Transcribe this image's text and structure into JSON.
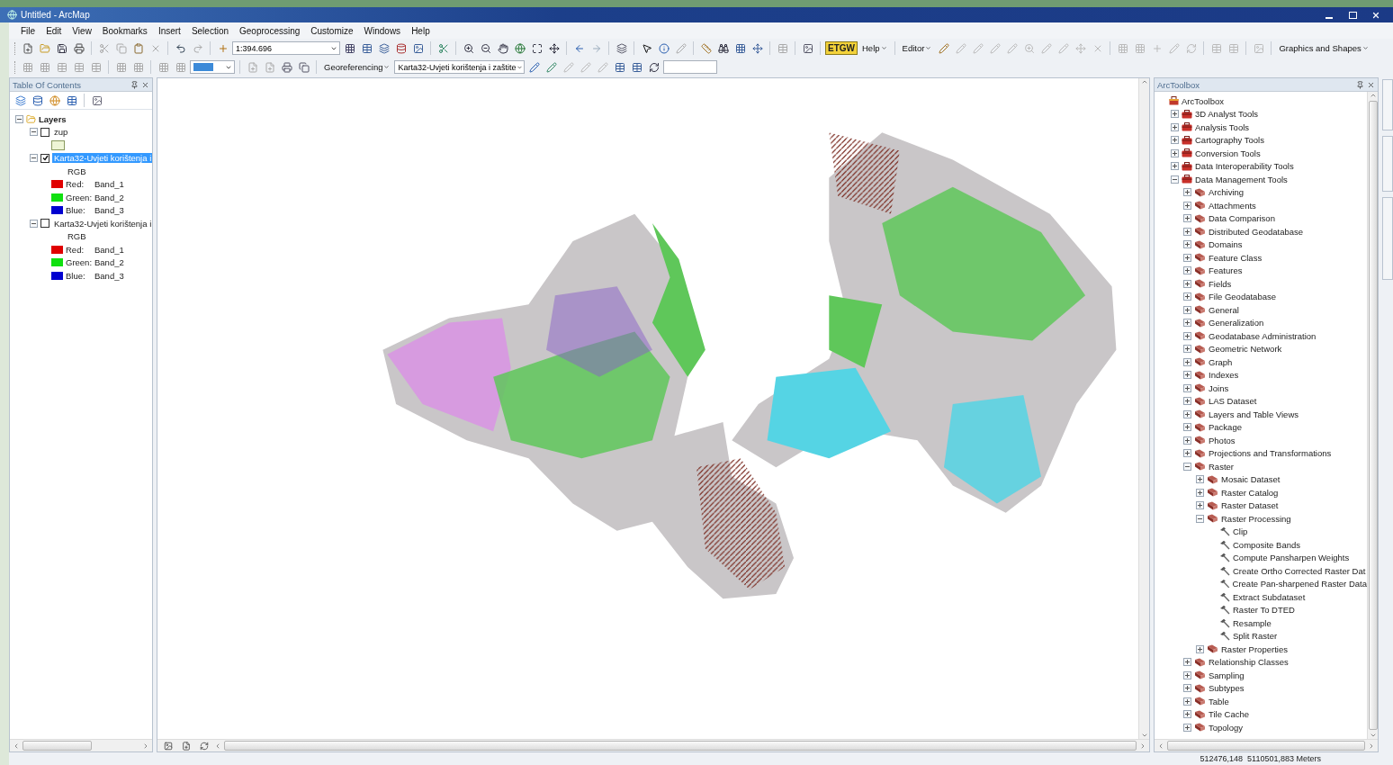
{
  "window": {
    "title": "Untitled - ArcMap"
  },
  "menu": [
    "File",
    "Edit",
    "View",
    "Bookmarks",
    "Insert",
    "Selection",
    "Geoprocessing",
    "Customize",
    "Windows",
    "Help"
  ],
  "toolbar_1": {
    "scale": "1:394.696",
    "logo": "ETGW",
    "menus": [
      "Help",
      "Editor",
      "Graphics and Shapes"
    ]
  },
  "toolbar_2": {
    "georeferencing": "Georeferencing",
    "layer": "Karta32-Uvjeti korištenja i zaštite"
  },
  "toc": {
    "title": "Table Of Contents",
    "root": {
      "label": "Layers",
      "expanded": true,
      "layers": [
        {
          "label": "zup",
          "checked": false,
          "selected": false,
          "expanded": true,
          "legend": [
            {
              "kind": "patch",
              "color": "#eef5d6"
            }
          ]
        },
        {
          "label": "Karta32-Uvjeti korištenja i",
          "checked": true,
          "selected": true,
          "expanded": true,
          "legend": [
            {
              "kind": "heading",
              "text": "RGB"
            },
            {
              "kind": "band",
              "color": "#e00000",
              "channel": "Red:",
              "band": "Band_1"
            },
            {
              "kind": "band",
              "color": "#10e010",
              "channel": "Green:",
              "band": "Band_2"
            },
            {
              "kind": "band",
              "color": "#0000d0",
              "channel": "Blue:",
              "band": "Band_3"
            }
          ]
        },
        {
          "label": "Karta32-Uvjeti korištenja i",
          "checked": false,
          "selected": false,
          "expanded": true,
          "legend": [
            {
              "kind": "heading",
              "text": "RGB"
            },
            {
              "kind": "band",
              "color": "#e00000",
              "channel": "Red:",
              "band": "Band_1"
            },
            {
              "kind": "band",
              "color": "#10e010",
              "channel": "Green:",
              "band": "Band_2"
            },
            {
              "kind": "band",
              "color": "#0000d0",
              "channel": "Blue:",
              "band": "Band_3"
            }
          ]
        }
      ]
    }
  },
  "toolbox": {
    "title": "ArcToolbox",
    "root": {
      "kind": "root",
      "label": "ArcToolbox",
      "children": [
        {
          "kind": "toolbox",
          "label": "3D Analyst Tools",
          "expanded": false
        },
        {
          "kind": "toolbox",
          "label": "Analysis Tools",
          "expanded": false
        },
        {
          "kind": "toolbox",
          "label": "Cartography Tools",
          "expanded": false
        },
        {
          "kind": "toolbox",
          "label": "Conversion Tools",
          "expanded": false
        },
        {
          "kind": "toolbox",
          "label": "Data Interoperability Tools",
          "expanded": false
        },
        {
          "kind": "toolbox",
          "label": "Data Management Tools",
          "expanded": true,
          "children": [
            {
              "kind": "toolset",
              "label": "Archiving",
              "expanded": false
            },
            {
              "kind": "toolset",
              "label": "Attachments",
              "expanded": false
            },
            {
              "kind": "toolset",
              "label": "Data Comparison",
              "expanded": false
            },
            {
              "kind": "toolset",
              "label": "Distributed Geodatabase",
              "expanded": false
            },
            {
              "kind": "toolset",
              "label": "Domains",
              "expanded": false
            },
            {
              "kind": "toolset",
              "label": "Feature Class",
              "expanded": false
            },
            {
              "kind": "toolset",
              "label": "Features",
              "expanded": false
            },
            {
              "kind": "toolset",
              "label": "Fields",
              "expanded": false
            },
            {
              "kind": "toolset",
              "label": "File Geodatabase",
              "expanded": false
            },
            {
              "kind": "toolset",
              "label": "General",
              "expanded": false
            },
            {
              "kind": "toolset",
              "label": "Generalization",
              "expanded": false
            },
            {
              "kind": "toolset",
              "label": "Geodatabase Administration",
              "expanded": false
            },
            {
              "kind": "toolset",
              "label": "Geometric Network",
              "expanded": false
            },
            {
              "kind": "toolset",
              "label": "Graph",
              "expanded": false
            },
            {
              "kind": "toolset",
              "label": "Indexes",
              "expanded": false
            },
            {
              "kind": "toolset",
              "label": "Joins",
              "expanded": false
            },
            {
              "kind": "toolset",
              "label": "LAS Dataset",
              "expanded": false
            },
            {
              "kind": "toolset",
              "label": "Layers and Table Views",
              "expanded": false
            },
            {
              "kind": "toolset",
              "label": "Package",
              "expanded": false
            },
            {
              "kind": "toolset",
              "label": "Photos",
              "expanded": false
            },
            {
              "kind": "toolset",
              "label": "Projections and Transformations",
              "expanded": false
            },
            {
              "kind": "toolset",
              "label": "Raster",
              "expanded": true,
              "children": [
                {
                  "kind": "toolset",
                  "label": "Mosaic Dataset",
                  "expanded": false
                },
                {
                  "kind": "toolset",
                  "label": "Raster Catalog",
                  "expanded": false
                },
                {
                  "kind": "toolset",
                  "label": "Raster Dataset",
                  "expanded": false
                },
                {
                  "kind": "toolset",
                  "label": "Raster Processing",
                  "expanded": true,
                  "children": [
                    {
                      "kind": "tool",
                      "label": "Clip"
                    },
                    {
                      "kind": "tool",
                      "label": "Composite Bands"
                    },
                    {
                      "kind": "tool",
                      "label": "Compute Pansharpen Weights"
                    },
                    {
                      "kind": "tool",
                      "label": "Create Ortho Corrected Raster Dat"
                    },
                    {
                      "kind": "tool",
                      "label": "Create Pan-sharpened Raster Data"
                    },
                    {
                      "kind": "tool",
                      "label": "Extract Subdataset"
                    },
                    {
                      "kind": "tool",
                      "label": "Raster To DTED"
                    },
                    {
                      "kind": "tool",
                      "label": "Resample"
                    },
                    {
                      "kind": "tool",
                      "label": "Split Raster"
                    }
                  ]
                },
                {
                  "kind": "toolset",
                  "label": "Raster Properties",
                  "expanded": false
                }
              ]
            },
            {
              "kind": "toolset",
              "label": "Relationship Classes",
              "expanded": false
            },
            {
              "kind": "toolset",
              "label": "Sampling",
              "expanded": false
            },
            {
              "kind": "toolset",
              "label": "Subtypes",
              "expanded": false
            },
            {
              "kind": "toolset",
              "label": "Table",
              "expanded": false
            },
            {
              "kind": "toolset",
              "label": "Tile Cache",
              "expanded": false
            },
            {
              "kind": "toolset",
              "label": "Topology",
              "expanded": false
            }
          ]
        }
      ]
    }
  },
  "status_bar": {
    "coordinates": "512476,148  5110501,883 Meters"
  }
}
